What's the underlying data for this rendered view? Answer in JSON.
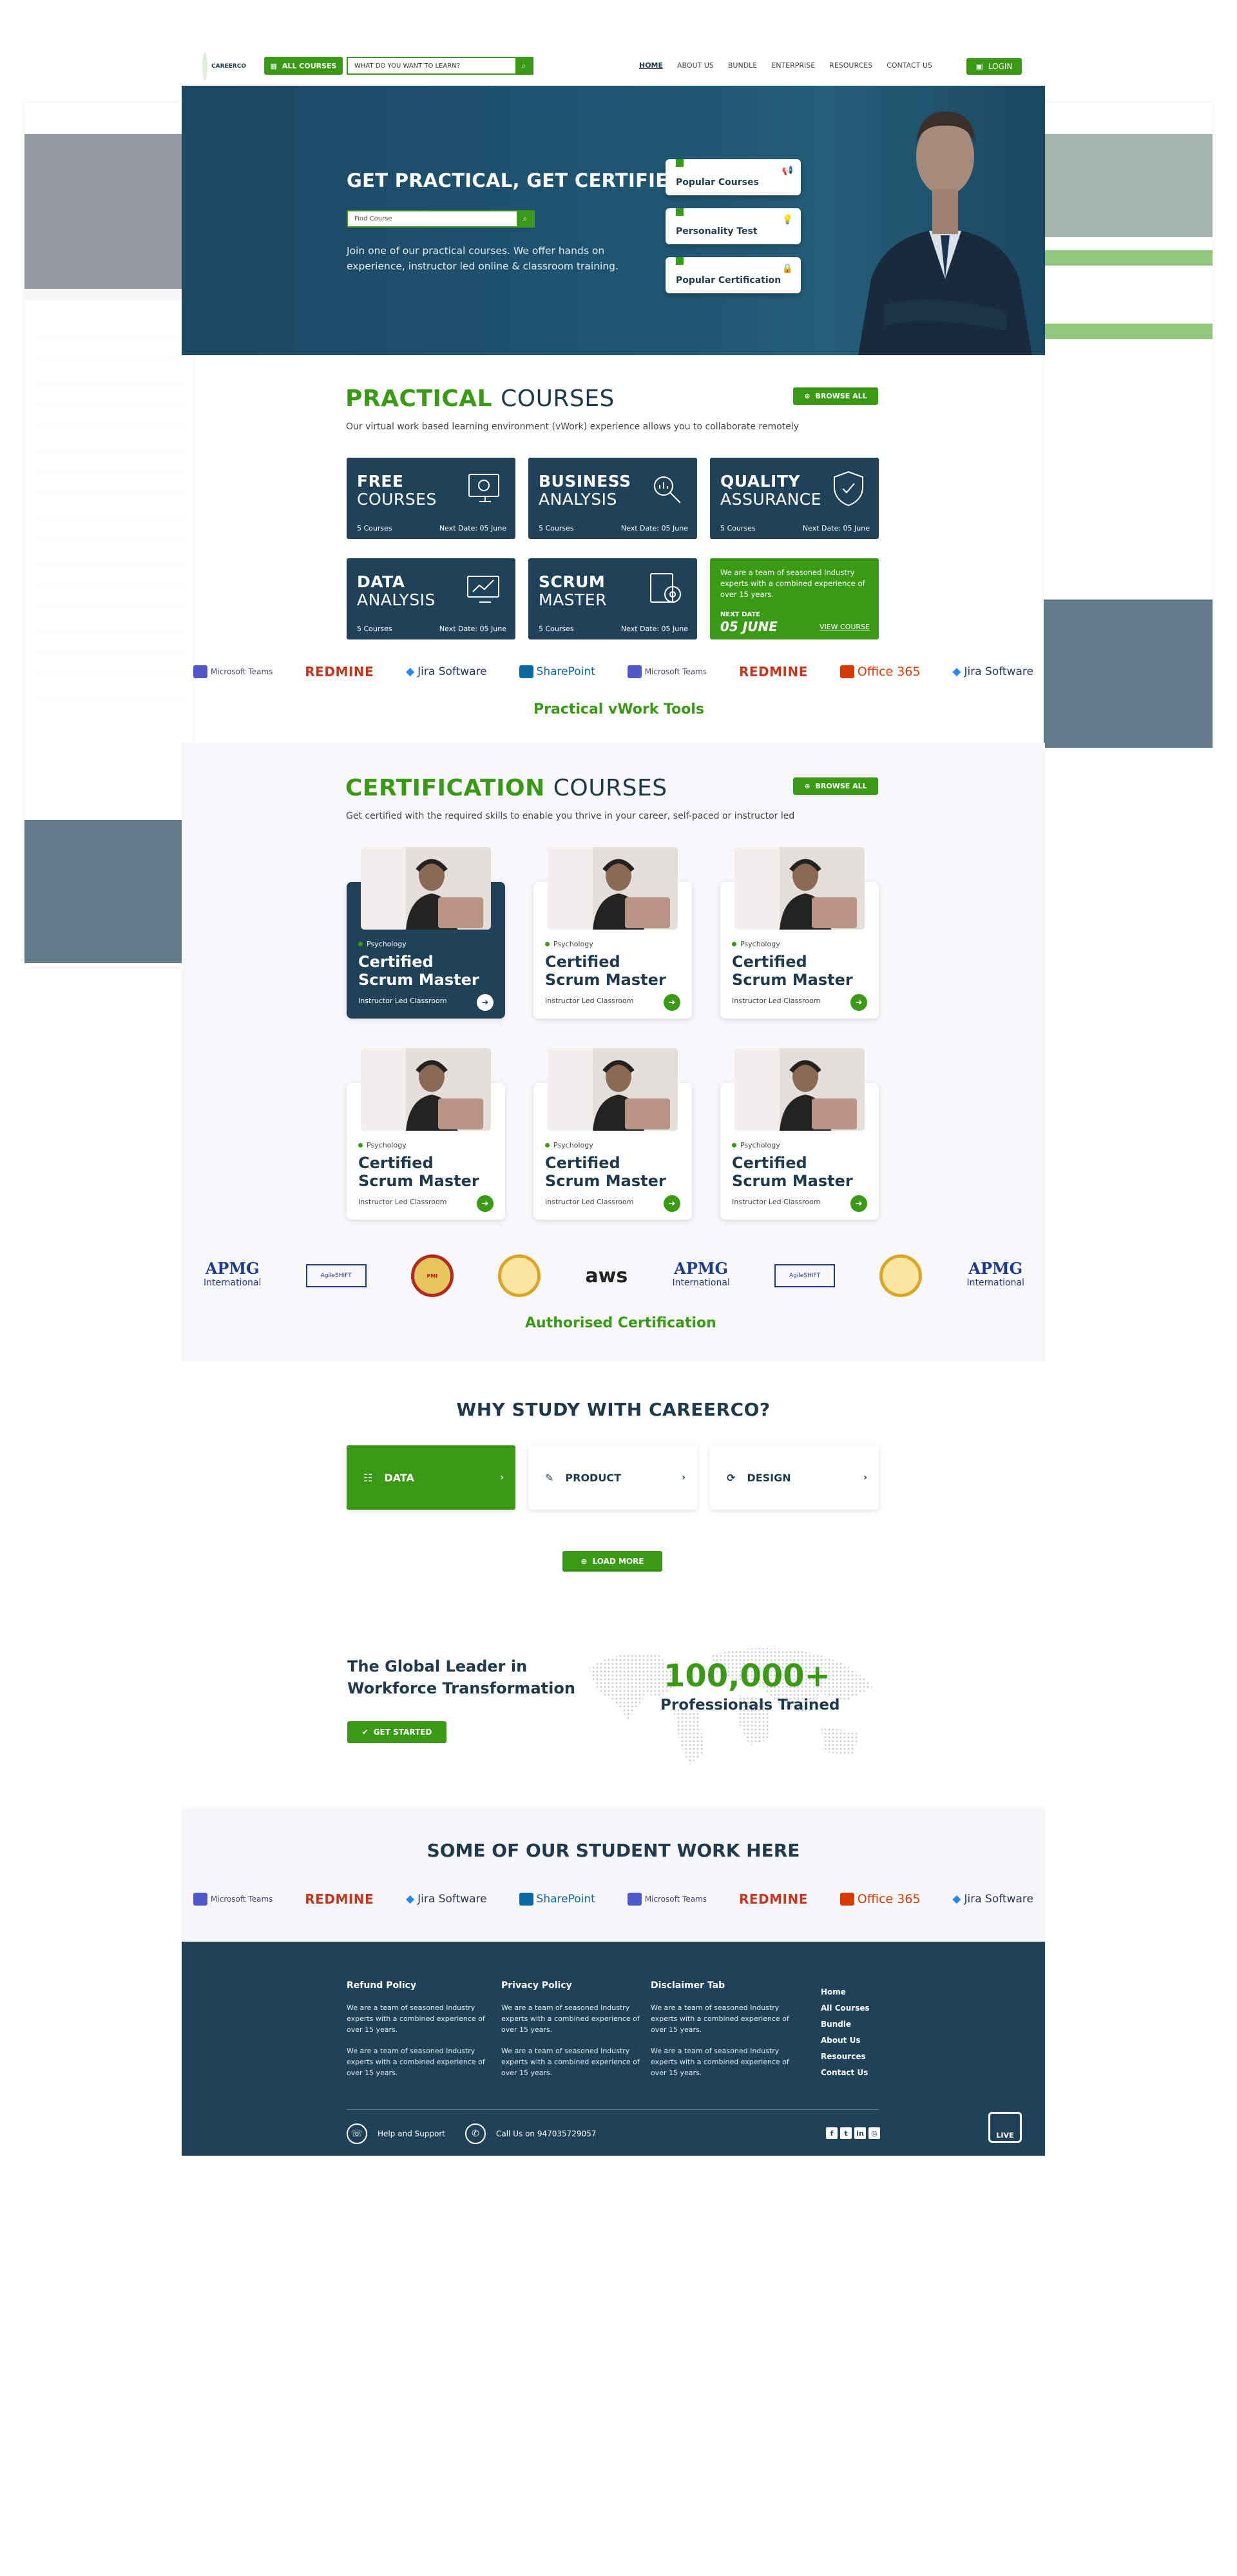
{
  "brand": {
    "name": "CAREERCO"
  },
  "header": {
    "all_courses": "ALL COURSES",
    "search_placeholder": "WHAT DO YOU WANT TO LEARN?",
    "nav": [
      "HOME",
      "ABOUT US",
      "BUNDLE",
      "ENTERPRISE",
      "RESOURCES",
      "CONTACT US"
    ],
    "login": "LOGIN"
  },
  "hero": {
    "title": "GET PRACTICAL, GET CERTIFIED.",
    "search_placeholder": "Find Course",
    "text": "Join one of our practical courses. We offer hands on experience, instructor led online & classroom training.",
    "cards": [
      "Popular Courses",
      "Personality Test",
      "Popular Certification"
    ]
  },
  "practical": {
    "title_green": "PRACTICAL",
    "title_rest": "COURSES",
    "subtitle": "Our virtual work based learning environment (vWork) experience allows you to collaborate remotely",
    "browse": "BROWSE ALL",
    "cards": [
      {
        "t1": "FREE",
        "t2": "COURSES",
        "count": "5 Courses",
        "next": "Next Date: 05 June"
      },
      {
        "t1": "BUSINESS",
        "t2": "ANALYSIS",
        "count": "5 Courses",
        "next": "Next Date: 05 June"
      },
      {
        "t1": "QUALITY",
        "t2": "ASSURANCE",
        "count": "5 Courses",
        "next": "Next Date: 05 June"
      },
      {
        "t1": "DATA",
        "t2": "ANALYSIS",
        "count": "5 Courses",
        "next": "Next Date: 05 June"
      },
      {
        "t1": "SCRUM",
        "t2": "MASTER",
        "count": "5 Courses",
        "next": "Next Date: 05 June"
      }
    ],
    "promo": {
      "text": "We are a team of seasoned Industry experts with a combined experience of over 15 years.",
      "next_label": "NEXT DATE",
      "date": "05 JUNE",
      "link": "VIEW COURSE"
    },
    "tools_title": "Practical vWork Tools"
  },
  "tools": [
    "Microsoft Teams",
    "REDMINE",
    "Jira Software",
    "SharePoint",
    "Microsoft Teams",
    "REDMINE",
    "Office 365",
    "Jira Software"
  ],
  "certification": {
    "title_green": "CERTIFICATION",
    "title_rest": "COURSES",
    "subtitle": "Get certified with the required skills to enable you thrive in your career, self-paced or instructor led",
    "browse": "BROWSE ALL",
    "cards": [
      {
        "cat": "Psychology",
        "name": "Certified Scrum Master",
        "type": "Instructor Led Classroom"
      },
      {
        "cat": "Psychology",
        "name": "Certified Scrum Master",
        "type": "Instructor Led Classroom"
      },
      {
        "cat": "Psychology",
        "name": "Certified Scrum Master",
        "type": "Instructor Led Classroom"
      },
      {
        "cat": "Psychology",
        "name": "Certified Scrum Master",
        "type": "Instructor Led Classroom"
      },
      {
        "cat": "Psychology",
        "name": "Certified Scrum Master",
        "type": "Instructor Led Classroom"
      },
      {
        "cat": "Psychology",
        "name": "Certified Scrum Master",
        "type": "Instructor Led Classroom"
      }
    ],
    "partners": [
      "APMG International",
      "AgileSHIFT",
      "PMI",
      "badge",
      "aws",
      "APMG International",
      "AgileSHIFT",
      "badge",
      "APMG International"
    ],
    "partners_title": "Authorised Certification"
  },
  "why": {
    "title": "WHY STUDY WITH CAREERCO?",
    "tabs": [
      "DATA",
      "PRODUCT",
      "DESIGN"
    ],
    "load_more": "LOAD MORE"
  },
  "leader": {
    "title": "The Global Leader in Workforce Transformation",
    "cta": "GET STARTED",
    "number": "100,000+",
    "number_label": "Professionals Trained"
  },
  "students": {
    "title": "SOME OF OUR STUDENT WORK HERE"
  },
  "footer": {
    "cols": [
      {
        "title": "Refund Policy",
        "p1": "We are a team of seasoned Industry experts with a combined experience of over 15 years.",
        "p2": "We are a team of seasoned Industry experts with a combined experience of over 15 years."
      },
      {
        "title": "Privacy Policy",
        "p1": "We are a team of seasoned Industry experts with a combined experience of over 15 years.",
        "p2": "We are a team of seasoned Industry experts with a combined experience of over 15 years."
      },
      {
        "title": "Disclaimer Tab",
        "p1": "We are a team of seasoned Industry experts with a combined experience of over 15 years.",
        "p2": "We are a team of seasoned Industry experts with a combined experience of over 15 years."
      }
    ],
    "links": [
      "Home",
      "All Courses",
      "Bundle",
      "About Us",
      "Resources",
      "Contact Us"
    ],
    "help": "Help and Support",
    "call": "Call Us on 947035729057",
    "live": "LIVE"
  },
  "colors": {
    "accent": "#3a9a16",
    "navy": "#1f4258"
  }
}
